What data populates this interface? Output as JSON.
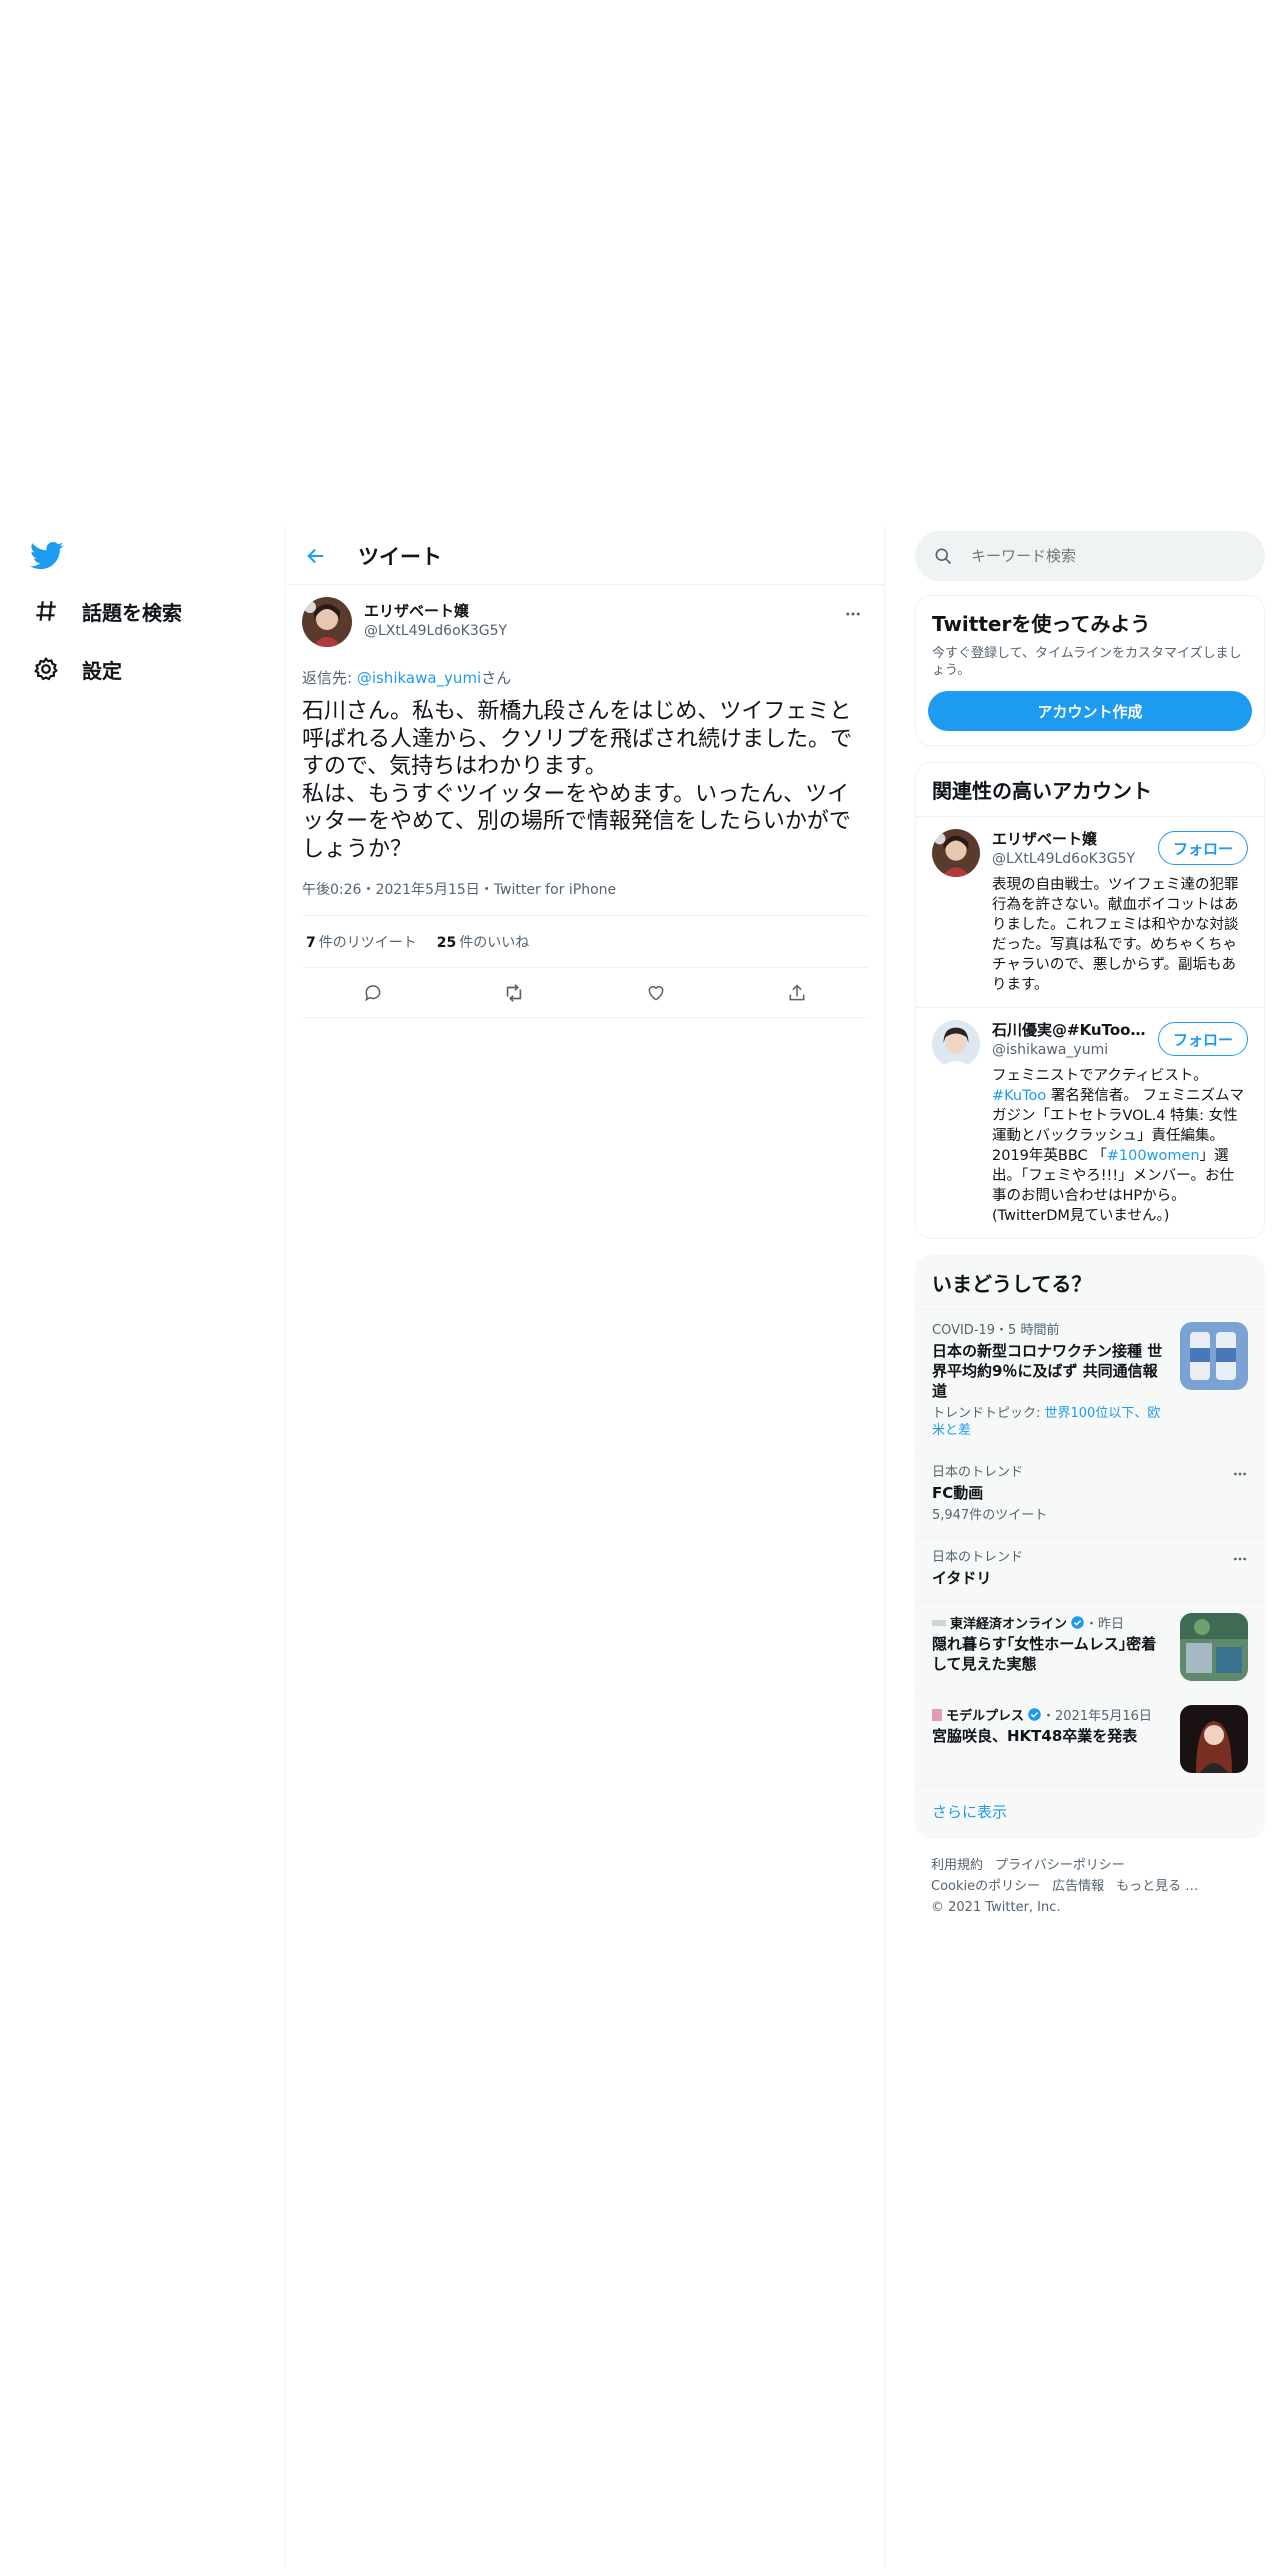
{
  "nav": {
    "logo": "twitter-bird",
    "explore_label": "話題を検索",
    "settings_label": "設定"
  },
  "header": {
    "title": "ツイート"
  },
  "tweet": {
    "author_name": "エリザベート嬢",
    "author_handle": "@LXtL49Ld6oK3G5Y",
    "reply_prefix": "返信先: ",
    "reply_mention": "@ishikawa_yumi",
    "reply_suffix": "さん",
    "text": "石川さん。私も、新橋九段さんをはじめ、ツイフェミと呼ばれる人達から、クソリプを飛ばされ続けました。ですので、気持ちはわかります。\n私は、もうすぐツイッターをやめます。いったん、ツイッターをやめて、別の場所で情報発信をしたらいかがでしょうか？",
    "meta": "午後0:26・2021年5月15日・Twitter for iPhone",
    "retweet_count": "7",
    "retweet_label": "件のリツイート",
    "like_count": "25",
    "like_label": "件のいいね"
  },
  "search": {
    "placeholder": "キーワード検索"
  },
  "signup_card": {
    "title": "Twitterを使ってみよう",
    "description": "今すぐ登録して、タイムラインをカスタマイズしましょう。",
    "button": "アカウント作成"
  },
  "relevant": {
    "title": "関連性の高いアカウント",
    "follow_label": "フォロー",
    "accounts": [
      {
        "name": "エリザベート嬢",
        "handle": "@LXtL49Ld6oK3G5Y",
        "bio": "表現の自由戦士。ツイフェミ達の犯罪行為を許さない。献血ボイコットはありました。これフェミは和やかな対談だった。写真は私です。めちゃくちゃチャラいので、悪しからず。副垢もあります。"
      },
      {
        "name": "石川優実@#KuToo署名",
        "handle": "@ishikawa_yumi",
        "bio_1": "フェミニストでアクティビスト。",
        "bio_tag1": "#KuToo",
        "bio_2": " 署名発信者。 フェミニズムマガジン「エトセトラVOL.4 特集: 女性運動とバックラッシュ」責任編集。2019年英BBC 「",
        "bio_tag2": "#100women",
        "bio_3": "」選出。「フェミやろ!!!」メンバー。お仕事のお問い合わせはHPから。(TwitterDM見ていません。)"
      }
    ]
  },
  "trends": {
    "title": "いまどうしてる？",
    "items": [
      {
        "context": "COVID-19・5 時間前",
        "title": "日本の新型コロナワクチン接種 世界平均約9％に及ばず 共同通信報道",
        "sub_prefix": "トレンドトピック: ",
        "sub_link": "世界100位以下、欧米と差"
      },
      {
        "context": "日本のトレンド",
        "title": "FC動画",
        "sub": "5,947件のツイート"
      },
      {
        "context": "日本のトレンド",
        "title": "イタドリ"
      },
      {
        "source": "東洋経済オンライン",
        "time": "・昨日",
        "title": "隠れ暮らす｢女性ホームレス｣密着して見えた実態"
      },
      {
        "source": "モデルプレス",
        "time": "・2021年5月16日",
        "title": "宮脇咲良、HKT48卒業を発表"
      }
    ],
    "show_more": "さらに表示"
  },
  "footer": {
    "links": [
      "利用規約",
      "プライバシーポリシー",
      "Cookieのポリシー",
      "広告情報",
      "もっと見る …"
    ],
    "copyright": "© 2021 Twitter, Inc."
  },
  "colors": {
    "accent": "#1d9bf0",
    "text": "#0f1419",
    "secondary": "#536471",
    "border": "#eff3f4"
  }
}
